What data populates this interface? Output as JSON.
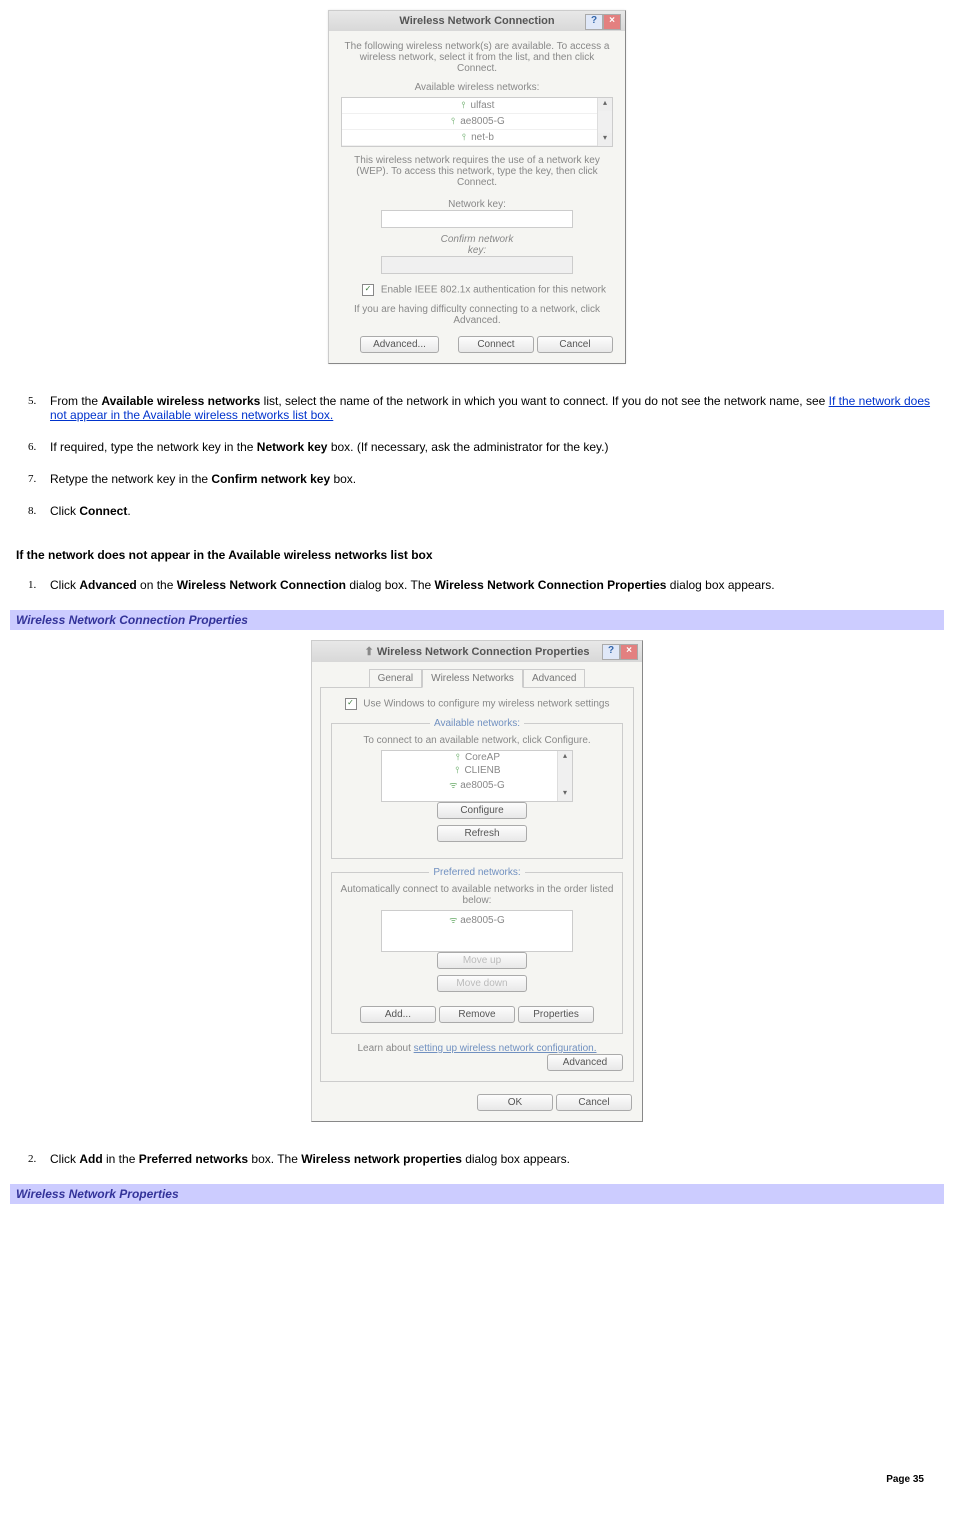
{
  "dlg1": {
    "title": "Wireless Network Connection",
    "desc": "The following wireless network(s) are available. To access a wireless network, select it from the list, and then click Connect.",
    "list_label": "Available wireless networks:",
    "networks": [
      "ulfast",
      "ae8005-G",
      "net-b"
    ],
    "wep_text": "This wireless network requires the use of a network key (WEP). To access this network, type the key, then click Connect.",
    "netkey_label": "Network key:",
    "confirm_label": "Confirm network key:",
    "chk_label": "Enable IEEE 802.1x authentication for this network",
    "adv_text": "If you are having difficulty connecting to a network, click Advanced.",
    "btn_adv": "Advanced...",
    "btn_connect": "Connect",
    "btn_cancel": "Cancel"
  },
  "list1": {
    "s5_a": "From the ",
    "s5_b": "Available wireless networks",
    "s5_c": " list, select the name of the network in which you want to connect. If you do not see the network name, see ",
    "s5_link": "If the network does not appear in the Available wireless networks list box.",
    "s6_a": "If required, type the network key in the ",
    "s6_b": "Network key",
    "s6_c": " box. (If necessary, ask the administrator for the key.)",
    "s7_a": "Retype the network key in the ",
    "s7_b": "Confirm network key",
    "s7_c": " box.",
    "s8_a": "Click ",
    "s8_b": "Connect",
    "s8_c": "."
  },
  "hdr1": "If the network does not appear in the Available wireless networks list box",
  "list2": {
    "s1_a": "Click ",
    "s1_b": "Advanced",
    "s1_c": " on the ",
    "s1_d": "Wireless Network Connection",
    "s1_e": " dialog box. The ",
    "s1_f": "Wireless Network Connection Properties",
    "s1_g": " dialog box appears."
  },
  "band1": "Wireless Network Connection Properties",
  "dlg2": {
    "title": "Wireless Network Connection Properties",
    "tab1": "General",
    "tab2": "Wireless Networks",
    "tab3": "Advanced",
    "chk_label": "Use Windows to configure my wireless network settings",
    "avail_legend": "Available networks:",
    "avail_text": "To connect to an available network, click Configure.",
    "avail": [
      "CoreAP",
      "CLIENB",
      "ae8005-G"
    ],
    "btn_configure": "Configure",
    "btn_refresh": "Refresh",
    "pref_legend": "Preferred networks:",
    "pref_text": "Automatically connect to available networks in the order listed below:",
    "pref": [
      "ae8005-G"
    ],
    "btn_moveup": "Move up",
    "btn_movedown": "Move down",
    "btn_add": "Add...",
    "btn_remove": "Remove",
    "btn_props": "Properties",
    "learn_a": "Learn about ",
    "learn_link": "setting up wireless network configuration.",
    "btn_advanced": "Advanced",
    "btn_ok": "OK",
    "btn_cancel": "Cancel"
  },
  "list3": {
    "s2_a": "Click ",
    "s2_b": "Add",
    "s2_c": " in the ",
    "s2_d": "Preferred networks",
    "s2_e": " box. The ",
    "s2_f": "Wireless network properties",
    "s2_g": " dialog box appears."
  },
  "band2": "Wireless Network Properties",
  "page_num": "Page 35"
}
